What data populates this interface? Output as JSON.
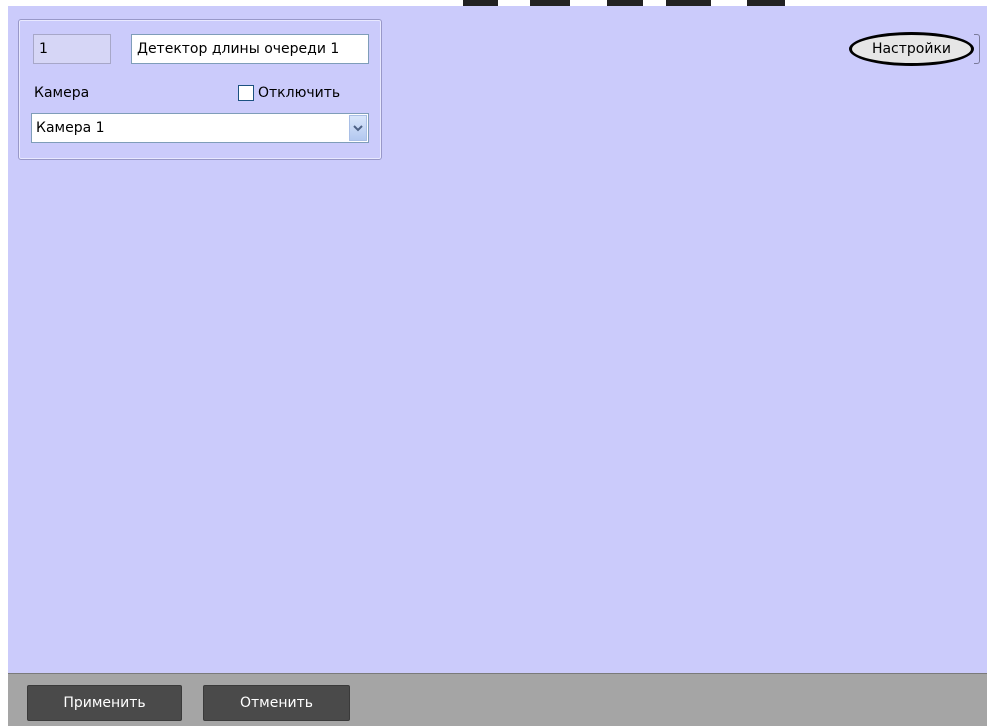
{
  "object": {
    "id_value": "1",
    "name_value": "Детектор длины очереди 1",
    "camera_label": "Камера",
    "disable_label": "Отключить",
    "disable_checked": false,
    "camera_selected": "Камера 1"
  },
  "toolbar": {
    "settings_label": "Настройки"
  },
  "footer": {
    "apply_label": "Применить",
    "cancel_label": "Отменить"
  },
  "icons": {
    "dropdown": "chevron-down-icon"
  },
  "colors": {
    "panel_background": "#cbcbfb",
    "footer_background": "#a5a5a5",
    "footer_button": "#4a4a4a"
  }
}
